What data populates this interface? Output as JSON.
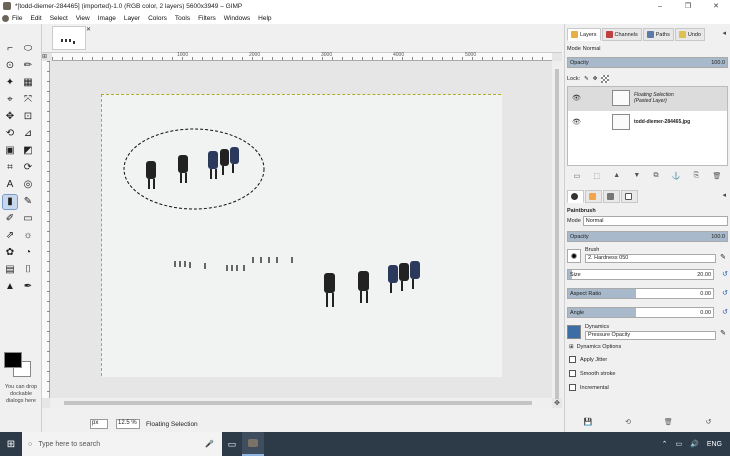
{
  "window": {
    "title": "*[todd-diemer-284465] (imported)-1.0 (RGB color, 2 layers) 5600x3949 – GIMP",
    "controls": [
      "–",
      "❐",
      "✕"
    ]
  },
  "menu": [
    "File",
    "Edit",
    "Select",
    "View",
    "Image",
    "Layer",
    "Colors",
    "Tools",
    "Filters",
    "Windows",
    "Help"
  ],
  "toolbox": {
    "tools": [
      "⌐",
      "⬭",
      "⊙",
      "✏",
      "✦",
      "▦",
      "⌖",
      "⤧",
      "✥",
      "⊡",
      "⟲",
      "⊿",
      "▣",
      "◩",
      "⌗",
      "⟳",
      "A",
      "◎",
      "▮",
      "✎",
      "✐",
      "▭",
      "⇗",
      "☼",
      "✿",
      "◔",
      "▤",
      "⌷",
      "▲",
      "✒"
    ],
    "active_index": 18,
    "drop_hint": "You can drop dockable dialogs here"
  },
  "canvas": {
    "ruler_labels": [
      "1000",
      "2000",
      "3000",
      "4000",
      "5000"
    ],
    "corner_tl": "⊞",
    "corner_nav": "✥"
  },
  "statusbar": {
    "unit": "px",
    "zoom": "12.5 %",
    "message": "Floating Selection"
  },
  "layers_dock": {
    "tabs": [
      "Layers",
      "Channels",
      "Paths",
      "Undo"
    ],
    "mode_label": "Mode",
    "mode_value": "Normal",
    "opacity_label": "Opacity",
    "opacity_value": "100.0",
    "lock_label": "Lock:",
    "layers": [
      {
        "name": "Floating Selection",
        "sub": "(Pasted Layer)",
        "selected": true
      },
      {
        "name": "todd-diemer-284465.jpg",
        "sub": "",
        "selected": false
      }
    ],
    "buttons": [
      "▭",
      "⬚",
      "▲",
      "▼",
      "⧉",
      "⚓",
      "⎘",
      "🗑"
    ]
  },
  "tool_options": {
    "tool_name": "Paintbrush",
    "mode_label": "Mode",
    "mode_value": "Normal",
    "opacity_label": "Opacity",
    "opacity_value": "100.0",
    "brush_label": "Brush",
    "brush_name": "2. Hardness 050",
    "size_label": "Size",
    "size_value": "20.00",
    "aspect_label": "Aspect Ratio",
    "aspect_value": "0.00",
    "angle_label": "Angle",
    "angle_value": "0.00",
    "dynamics_label": "Dynamics",
    "dynamics_value": "Pressure Opacity",
    "dynamics_options": "Dynamics Options",
    "apply_jitter": "Apply Jitter",
    "smooth_stroke": "Smooth stroke",
    "incremental": "Incremental",
    "bottom_buttons": [
      "💾",
      "⟲",
      "🗑",
      "↺"
    ]
  },
  "taskbar": {
    "search_placeholder": "Type here to search",
    "lang": "ENG"
  }
}
